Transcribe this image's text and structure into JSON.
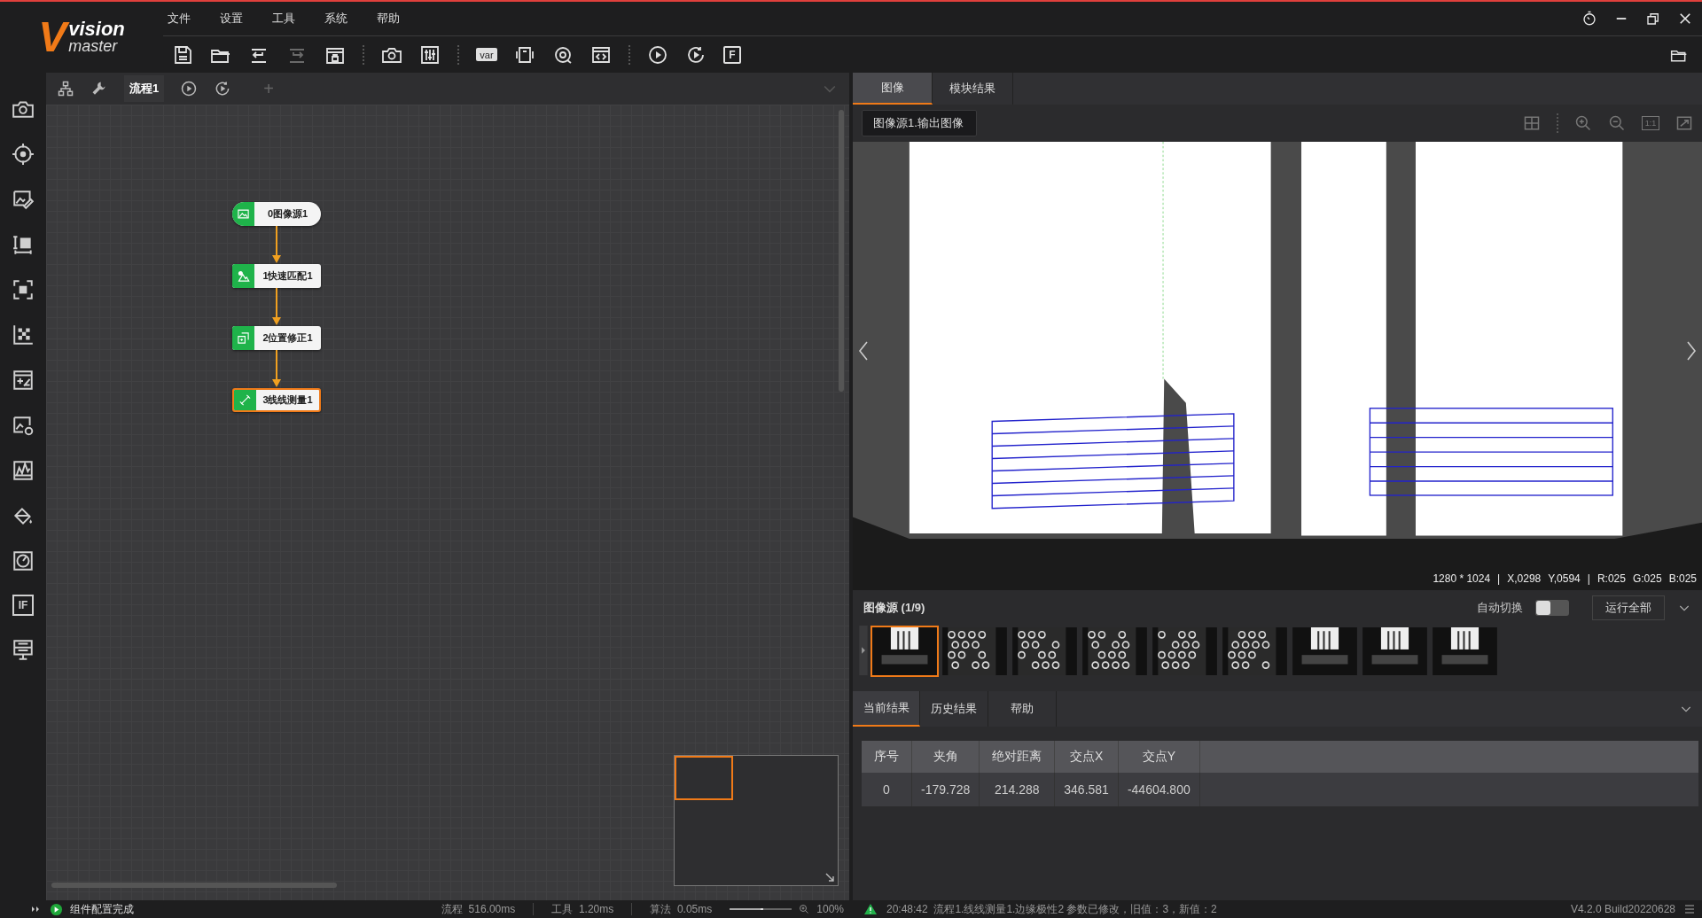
{
  "app": {
    "logo_letter": "V",
    "logo_line1": "vision",
    "logo_line2": "master"
  },
  "menu": [
    "文件",
    "设置",
    "工具",
    "系统",
    "帮助"
  ],
  "toolbar": [
    {
      "kind": "save",
      "disabled": false
    },
    {
      "kind": "open",
      "disabled": false
    },
    {
      "kind": "import",
      "disabled": false
    },
    {
      "kind": "export",
      "disabled": true
    },
    {
      "kind": "lock",
      "disabled": false
    },
    {
      "kind": "camera",
      "disabled": false
    },
    {
      "kind": "sliders",
      "disabled": false
    },
    {
      "kind": "var",
      "label": "var",
      "disabled": false
    },
    {
      "kind": "device",
      "disabled": false
    },
    {
      "kind": "rotate",
      "disabled": false
    },
    {
      "kind": "code",
      "disabled": false
    },
    {
      "kind": "run",
      "disabled": false
    },
    {
      "kind": "loop",
      "disabled": false
    },
    {
      "kind": "letter",
      "label": "F",
      "disabled": false
    }
  ],
  "sidebar": [
    {
      "kind": "camera"
    },
    {
      "kind": "target"
    },
    {
      "kind": "imgedit"
    },
    {
      "kind": "textbar"
    },
    {
      "kind": "focus"
    },
    {
      "kind": "calib"
    },
    {
      "kind": "calc"
    },
    {
      "kind": "imggear"
    },
    {
      "kind": "chart"
    },
    {
      "kind": "bucket"
    },
    {
      "kind": "gauge"
    },
    {
      "kind": "letter",
      "label": "IF"
    },
    {
      "kind": "adjust"
    }
  ],
  "flow_tabs": {
    "tab": {
      "label": "流程1",
      "selected": true
    },
    "add": "+"
  },
  "flow_nodes": [
    {
      "label": "0图像源1",
      "kind": "image",
      "selected": false
    },
    {
      "label": "1快速匹配1",
      "kind": "match",
      "selected": false
    },
    {
      "label": "2位置修正1",
      "kind": "fix",
      "selected": false
    },
    {
      "label": "3线线测量1",
      "kind": "measure",
      "selected": true
    }
  ],
  "right_tabs": [
    {
      "label": "图像",
      "selected": true
    },
    {
      "label": "模块结果",
      "selected": false
    }
  ],
  "image_source_select": "图像源1.输出图像",
  "image_tools": [
    {
      "kind": "grid"
    },
    {
      "kind": "zoomin"
    },
    {
      "kind": "zoomout"
    },
    {
      "kind": "letter",
      "label": "1:1"
    },
    {
      "kind": "fit"
    }
  ],
  "image_info": [
    "1280 * 1024",
    "|",
    "X,0298",
    "Y,0594",
    "|",
    "R:025",
    "G:025",
    "B:025"
  ],
  "source_panel": {
    "title": "图像源 (1/9)",
    "auto_switch_label": "自动切换",
    "auto_switch_on": false,
    "run_all": "运行全部"
  },
  "thumbnails": [
    {
      "kind": "bars",
      "selected": true
    },
    {
      "kind": "rings",
      "selected": false
    },
    {
      "kind": "rings",
      "selected": false
    },
    {
      "kind": "rings",
      "selected": false
    },
    {
      "kind": "rings",
      "selected": false
    },
    {
      "kind": "rings",
      "selected": false
    },
    {
      "kind": "bars",
      "selected": false
    },
    {
      "kind": "bars",
      "selected": false
    },
    {
      "kind": "bars",
      "selected": false
    }
  ],
  "result_tabs": [
    {
      "label": "当前结果",
      "selected": true
    },
    {
      "label": "历史结果",
      "selected": false
    },
    {
      "label": "帮助",
      "selected": false
    }
  ],
  "table": {
    "columns": [
      "序号",
      "夹角",
      "绝对距离",
      "交点X",
      "交点Y"
    ],
    "rows": [
      [
        "0",
        "-179.728",
        "214.288",
        "346.581",
        "-44604.800"
      ]
    ]
  },
  "status_bar": {
    "message": "组件配置完成",
    "flow_time": "流程  516.00ms",
    "tool_time": "工具  1.20ms",
    "algo_time": "算法  0.05ms",
    "zoom": {
      "level": 0.5
    },
    "zoom_text": "100%",
    "log": "20:48:42  流程1.线线测量1.边缘极性2 参数已修改，旧值：3，新值：2",
    "version": "V4.2.0 Build20220628"
  }
}
